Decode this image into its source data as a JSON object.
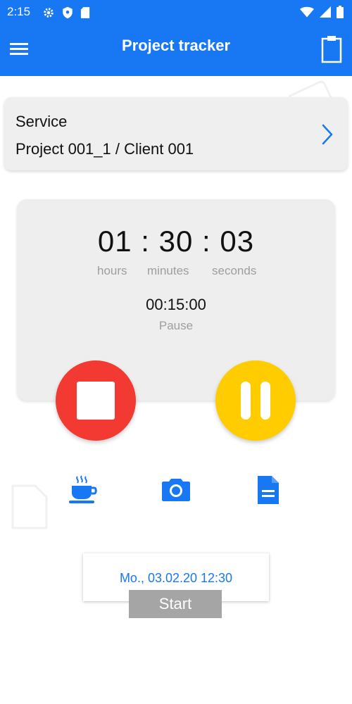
{
  "status_bar": {
    "time": "2:15",
    "icons": [
      "settings-icon",
      "shield-icon",
      "sd-card-icon",
      "wifi-icon",
      "signal-icon",
      "battery-icon"
    ]
  },
  "app_bar": {
    "title": "Project tracker",
    "icons": [
      "menu-icon",
      "clipboard-icon"
    ]
  },
  "service": {
    "label": "Service",
    "value": "Project 001_1 / Client 001"
  },
  "timer": {
    "hours": "01",
    "minutes": "30",
    "seconds": "03",
    "separator": ":",
    "hours_label": "hours",
    "minutes_label": "minutes",
    "seconds_label": "seconds",
    "pause_time": "00:15:00",
    "pause_label": "Pause"
  },
  "actions": [
    "stop-icon",
    "pause-icon",
    "coffee-icon",
    "camera-icon",
    "document-icon"
  ],
  "footer": {
    "datetime": "Mo., 03.02.20 12:30",
    "start_label": "Start"
  },
  "colors": {
    "primary": "#1877f2",
    "stop": "#f23a32",
    "pause": "#ffcc00",
    "start_button": "#a5a5a5"
  }
}
